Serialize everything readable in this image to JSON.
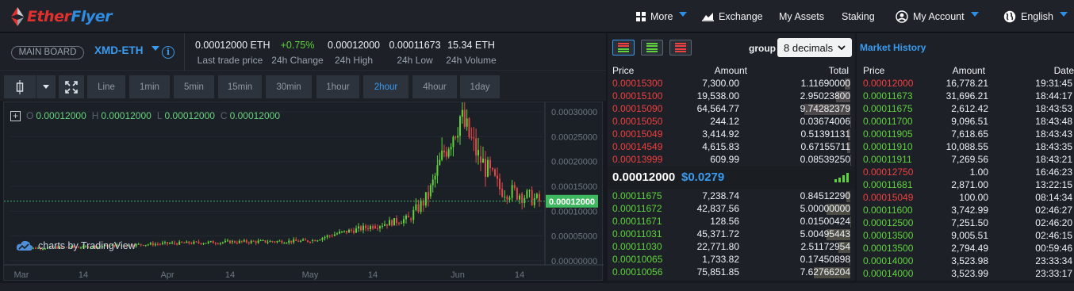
{
  "brand": {
    "name_part1": "Ether",
    "name_part2": "Flyer",
    "colors": {
      "red": "#e2302f",
      "blue": "#2f8de4"
    }
  },
  "nav": {
    "more": "More",
    "exchange": "Exchange",
    "my_assets": "My Assets",
    "staking": "Staking",
    "my_account": "My Account",
    "language": "English"
  },
  "market": {
    "board": "MAIN BOARD",
    "pair": "XMD-ETH",
    "info_icon": "i",
    "stats": [
      {
        "value": "0.00012000 ETH",
        "label": "Last trade price",
        "color": "#eef1f4"
      },
      {
        "value": "+0.75%",
        "label": "24h Change",
        "color": "#5fd23c"
      },
      {
        "value": "0.00012000",
        "label": "24h High",
        "color": "#eef1f4"
      },
      {
        "value": "0.00011673",
        "label": "24h Low",
        "color": "#eef1f4"
      },
      {
        "value": "15.34 ETH",
        "label": "24h Volume",
        "color": "#eef1f4"
      }
    ]
  },
  "toolbar": {
    "intervals": [
      "Line",
      "1min",
      "5min",
      "15min",
      "30min",
      "1hour",
      "2hour",
      "4hour",
      "1day"
    ],
    "active": "2hour",
    "icons": [
      "candlestick-icon",
      "chevron-down-icon",
      "fullscreen-icon"
    ]
  },
  "chart": {
    "ohlc": {
      "o_key": "O",
      "o": "0.00012000",
      "h_key": "H",
      "h": "0.00012000",
      "l_key": "L",
      "l": "0.00012000",
      "c_key": "C",
      "c": "0.00012000"
    },
    "watermark": "charts by TradingView",
    "price_tag": "0.00012000"
  },
  "chart_data": {
    "type": "candlestick",
    "title": "",
    "xlabel": "",
    "ylabel": "",
    "y_ticks": [
      "0.00030000",
      "0.00025000",
      "0.00020000",
      "0.00015000",
      "0.00010000",
      "0.00005000",
      "0.00000000"
    ],
    "x_ticks": [
      "Mar",
      "14",
      "Apr",
      "14",
      "May",
      "14",
      "Jun",
      "14"
    ],
    "ylim": [
      0,
      0.0003
    ],
    "last_price": 0.00012,
    "approx_close_path": [
      {
        "t": "Mar 1",
        "close": 2.5e-05
      },
      {
        "t": "Mar 14",
        "close": 2.8e-05
      },
      {
        "t": "Apr 1",
        "close": 3.5e-05
      },
      {
        "t": "Apr 14",
        "close": 3.8e-05
      },
      {
        "t": "May 1",
        "close": 4e-05
      },
      {
        "t": "May 7",
        "close": 5.5e-05
      },
      {
        "t": "May 14",
        "close": 7e-05
      },
      {
        "t": "May 21",
        "close": 8.5e-05
      },
      {
        "t": "May 25",
        "close": 0.00013
      },
      {
        "t": "May 28",
        "close": 0.00022
      },
      {
        "t": "Jun 1",
        "close": 0.00029
      },
      {
        "t": "Jun 5",
        "close": 0.00021
      },
      {
        "t": "Jun 10",
        "close": 0.000145
      },
      {
        "t": "Jun 14",
        "close": 0.000135
      },
      {
        "t": "Jun 20",
        "close": 0.00012
      }
    ]
  },
  "orderbook": {
    "group_label": "group",
    "group_value": "8 decimals",
    "headers": {
      "price": "Price",
      "amount": "Amount",
      "total": "Total"
    },
    "asks": [
      [
        "0.00015300",
        "7,300.00",
        "1.11690000"
      ],
      [
        "0.00015100",
        "19,538.00",
        "2.95023800"
      ],
      [
        "0.00015090",
        "64,564.77",
        "9.74282379"
      ],
      [
        "0.00015050",
        "244.12",
        "0.03674006"
      ],
      [
        "0.00015049",
        "3,414.92",
        "0.51391131"
      ],
      [
        "0.00014549",
        "4,615.83",
        "0.67155711"
      ],
      [
        "0.00013999",
        "609.99",
        "0.08539250"
      ]
    ],
    "last_price": "0.00012000",
    "last_usd": "$0.0279",
    "bids": [
      [
        "0.00011675",
        "7,238.74",
        "0.84512290"
      ],
      [
        "0.00011672",
        "42,837.56",
        "5.00000000"
      ],
      [
        "0.00011671",
        "128.56",
        "0.01500424"
      ],
      [
        "0.00011031",
        "45,371.72",
        "5.00495443"
      ],
      [
        "0.00011030",
        "22,771.80",
        "2.51172954"
      ],
      [
        "0.00010065",
        "1,733.82",
        "0.17450898"
      ],
      [
        "0.00010056",
        "75,851.85",
        "7.62766204"
      ]
    ]
  },
  "history": {
    "title": "Market History",
    "headers": {
      "price": "Price",
      "amount": "Amount",
      "date": "Date"
    },
    "rows": [
      {
        "price": "0.00012000",
        "amount": "16,778.21",
        "time": "19:31:45",
        "side": "sell"
      },
      {
        "price": "0.00011673",
        "amount": "31,696.21",
        "time": "18:44:17",
        "side": "buy"
      },
      {
        "price": "0.00011675",
        "amount": "2,612.42",
        "time": "18:43:53",
        "side": "buy"
      },
      {
        "price": "0.00011700",
        "amount": "9,096.51",
        "time": "18:43:48",
        "side": "buy"
      },
      {
        "price": "0.00011905",
        "amount": "7,618.65",
        "time": "18:43:43",
        "side": "buy"
      },
      {
        "price": "0.00011910",
        "amount": "10,088.55",
        "time": "18:43:35",
        "side": "buy"
      },
      {
        "price": "0.00011911",
        "amount": "7,269.56",
        "time": "18:43:21",
        "side": "buy"
      },
      {
        "price": "0.00012750",
        "amount": "1.00",
        "time": "16:46:23",
        "side": "sell"
      },
      {
        "price": "0.00011681",
        "amount": "2,871.00",
        "time": "13:22:15",
        "side": "buy"
      },
      {
        "price": "0.00015049",
        "amount": "100.00",
        "time": "08:14:34",
        "side": "sell"
      },
      {
        "price": "0.00011600",
        "amount": "3,742.99",
        "time": "02:46:27",
        "side": "buy"
      },
      {
        "price": "0.00012500",
        "amount": "7,251.50",
        "time": "02:46:20",
        "side": "buy"
      },
      {
        "price": "0.00013500",
        "amount": "9,005.51",
        "time": "02:46:15",
        "side": "buy"
      },
      {
        "price": "0.00013500",
        "amount": "2,794.49",
        "time": "00:59:46",
        "side": "buy"
      },
      {
        "price": "0.00014000",
        "amount": "3,523.98",
        "time": "23:33:34",
        "side": "buy"
      },
      {
        "price": "0.00014000",
        "amount": "3,523.99",
        "time": "23:33:17",
        "side": "buy"
      }
    ]
  }
}
